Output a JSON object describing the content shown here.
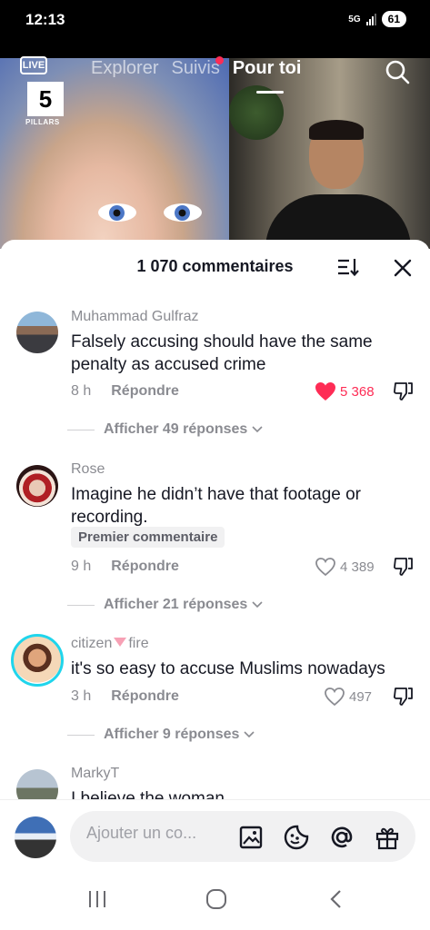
{
  "status_bar": {
    "time": "12:13",
    "network": "5G",
    "battery": "61"
  },
  "live": {
    "badge": "LIVE",
    "channel_number": "5",
    "channel_name": "PILLARS"
  },
  "top_nav": {
    "tabs": [
      "Explorer",
      "Suivis",
      "Pour toi"
    ],
    "active_tab": "Pour toi"
  },
  "comments_sheet": {
    "title": "1 070 commentaires",
    "comments": [
      {
        "author": "Muhammad Gulfraz",
        "text": "Falsely accusing should have the same penalty as accused crime",
        "time": "8 h",
        "reply_label": "Répondre",
        "likes": "5 368",
        "liked": true,
        "view_replies": "Afficher 49 réponses"
      },
      {
        "author": "Rose",
        "text": "Imagine he didn’t have that footage or recording.",
        "badge": "Premier commentaire",
        "time": "9 h",
        "reply_label": "Répondre",
        "likes": "4 389",
        "liked": false,
        "view_replies": "Afficher 21 réponses"
      },
      {
        "author_prefix": "citizen",
        "author_suffix": "fire",
        "text": "it's so easy to accuse Muslims nowadays",
        "time": "3 h",
        "reply_label": "Répondre",
        "likes": "497",
        "liked": false,
        "view_replies": "Afficher 9 réponses"
      },
      {
        "author": "MarkyT",
        "text": "I believe the woman"
      }
    ]
  },
  "input": {
    "placeholder": "Ajouter un co..."
  },
  "colors": {
    "accent": "#fe2c55",
    "muted": "#8a8b91",
    "text": "#161823"
  }
}
